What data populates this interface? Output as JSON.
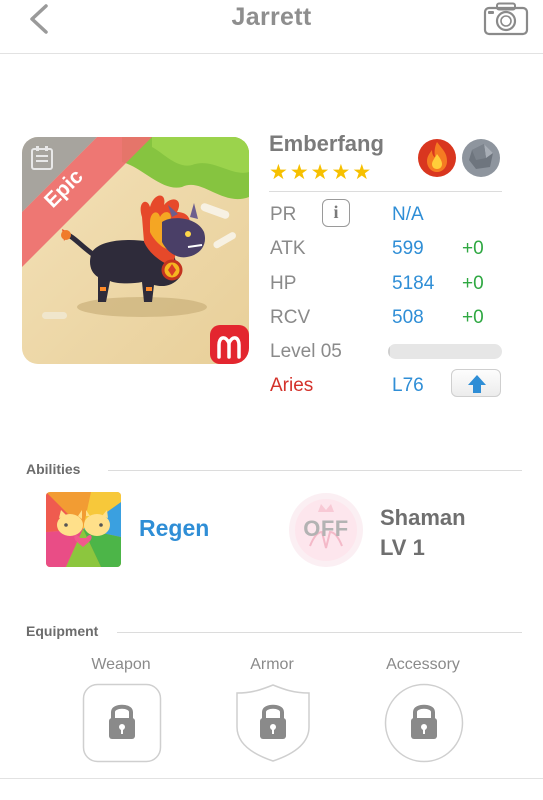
{
  "header": {
    "title": "Jarrett",
    "back_icon": "chevron-left-icon",
    "camera_icon": "camera-icon"
  },
  "pet": {
    "rarity": "Epic",
    "name": "Emberfang",
    "stars": 5,
    "elements": [
      "fire-element-icon",
      "stone-element-icon"
    ],
    "zodiac_icon": "aries-icon"
  },
  "stats": {
    "pr": {
      "label": "PR",
      "value": "N/A"
    },
    "atk": {
      "label": "ATK",
      "value": "599",
      "bonus": "+0"
    },
    "hp": {
      "label": "HP",
      "value": "5184",
      "bonus": "+0"
    },
    "rcv": {
      "label": "RCV",
      "value": "508",
      "bonus": "+0"
    },
    "level": {
      "label": "Level 05",
      "progress": 0.02
    },
    "sign": {
      "label": "Aries",
      "value": "L76"
    }
  },
  "abilities": {
    "title": "Abilities",
    "skill": {
      "name": "Regen"
    },
    "shaman": {
      "toggle": "OFF",
      "name": "Shaman",
      "level": "LV 1"
    }
  },
  "equipment": {
    "title": "Equipment",
    "slots": [
      {
        "label": "Weapon",
        "icon": "lock-icon"
      },
      {
        "label": "Armor",
        "icon": "lock-icon"
      },
      {
        "label": "Accessory",
        "icon": "lock-icon"
      }
    ]
  },
  "colors": {
    "accent_blue": "#2f8ed6",
    "bonus_green": "#2fa842",
    "sign_red": "#d4322b",
    "star_gold": "#f6c000",
    "epic_red": "#ee6e6e"
  }
}
